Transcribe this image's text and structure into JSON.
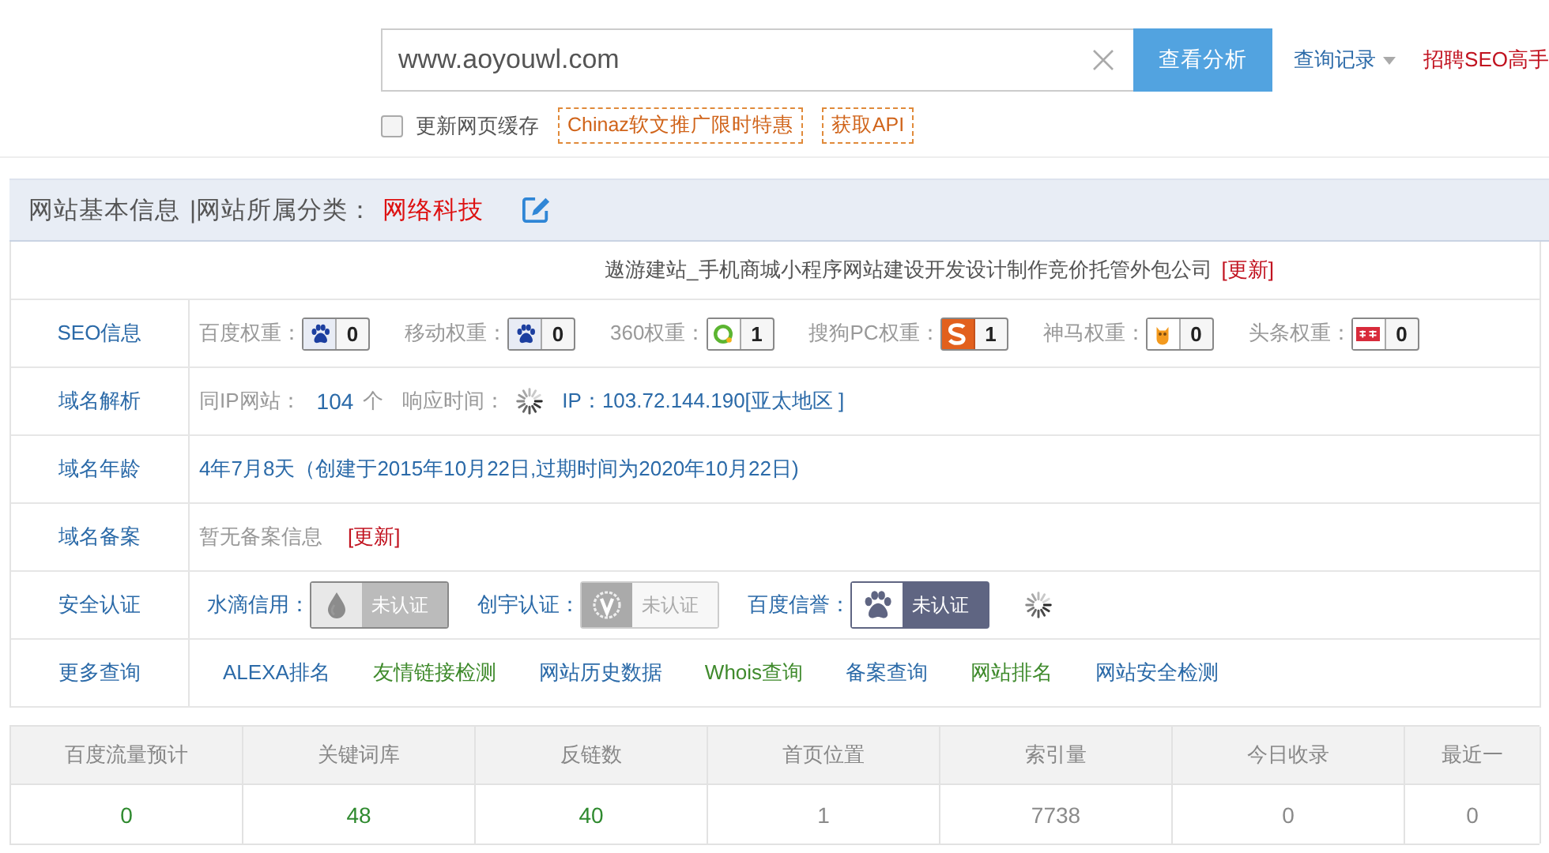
{
  "search": {
    "value": "www.aoyouwl.com",
    "button": "查看分析",
    "history": "查询记录",
    "promo": "招聘SEO高手"
  },
  "options": {
    "cache_label": "更新网页缓存",
    "cache_checked": false,
    "tags": [
      "Chinaz软文推广限时特惠",
      "获取API"
    ]
  },
  "panel": {
    "title": "网站基本信息",
    "category_label": "|网站所属分类：",
    "category": "网络科技",
    "site_title": "遨游建站_手机商城小程序网站建设开发设计制作竞价托管外包公司",
    "site_title_update": "[更新]",
    "rows": [
      {
        "kind": "weights",
        "label": "SEO信息",
        "items": [
          {
            "label": "百度权重：",
            "kind": "paw",
            "value": "0"
          },
          {
            "label": "移动权重：",
            "kind": "paw",
            "value": "0"
          },
          {
            "label": "360权重：",
            "kind": "ring",
            "value": "1"
          },
          {
            "label": "搜狗PC权重：",
            "kind": "sogou",
            "value": "1"
          },
          {
            "label": "神马权重：",
            "kind": "owl",
            "value": "0"
          },
          {
            "label": "头条权重：",
            "kind": "toutiao",
            "value": "0"
          }
        ]
      },
      {
        "kind": "dns",
        "label": "域名解析",
        "same_ip_label": "同IP网站：",
        "same_ip_count": "104",
        "unit": "个",
        "response_label": "响应时间：",
        "ip": "IP：103.72.144.190[亚太地区 ]"
      },
      {
        "kind": "text",
        "label": "域名年龄",
        "text": "4年7月8天（创建于2015年10月22日,过期时间为2020年10月22日)"
      },
      {
        "kind": "icp",
        "label": "域名备案",
        "text": "暂无备案信息",
        "update": "[更新]"
      },
      {
        "kind": "certs",
        "label": "安全认证",
        "items": [
          {
            "label": "水滴信用：",
            "kind": "drop",
            "status": "未认证"
          },
          {
            "label": "创宇认证：",
            "kind": "laurel",
            "status": "未认证"
          },
          {
            "label": "百度信誉：",
            "kind": "paw",
            "status": "未认证"
          }
        ]
      },
      {
        "kind": "links",
        "label": "更多查询",
        "links": [
          {
            "text": "ALEXA排名",
            "color": "#2b6aa8"
          },
          {
            "text": "友情链接检测",
            "color": "#3f8a2c"
          },
          {
            "text": "网站历史数据",
            "color": "#2b6aa8"
          },
          {
            "text": "Whois查询",
            "color": "#3f8a2c"
          },
          {
            "text": "备案查询",
            "color": "#2b6aa8"
          },
          {
            "text": "网站排名",
            "color": "#3f8a2c"
          },
          {
            "text": "网站安全检测",
            "color": "#2b6aa8"
          }
        ]
      }
    ]
  },
  "stats": {
    "columns": [
      "百度流量预计",
      "关键词库",
      "反链数",
      "首页位置",
      "索引量",
      "今日收录",
      "最近一"
    ],
    "values": [
      {
        "text": "0",
        "color": "#2f8a2f"
      },
      {
        "text": "48",
        "color": "#2f8a2f"
      },
      {
        "text": "40",
        "color": "#2f8a2f"
      },
      {
        "text": "1",
        "color": "#8a8a8a"
      },
      {
        "text": "7738",
        "color": "#8a8a8a"
      },
      {
        "text": "0",
        "color": "#8a8a8a"
      },
      {
        "text": "0",
        "color": "#8a8a8a"
      }
    ]
  }
}
